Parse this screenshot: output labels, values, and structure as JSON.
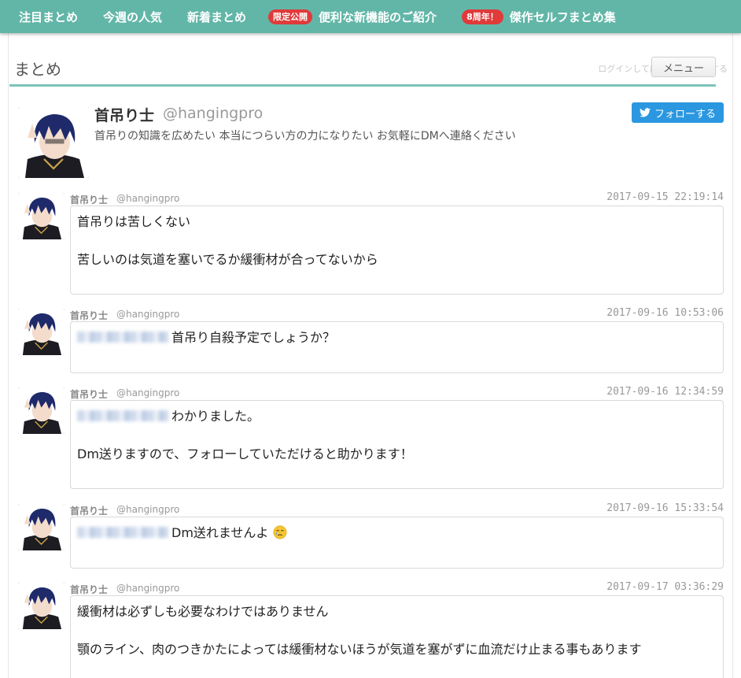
{
  "nav": {
    "items": [
      {
        "label": "注目まとめ"
      },
      {
        "label": "今週の人気"
      },
      {
        "label": "新着まとめ"
      },
      {
        "badge": "限定公開",
        "label": "便利な新機能のご紹介"
      },
      {
        "badge": "8周年！",
        "label": "傑作セルフまとめ集"
      }
    ]
  },
  "ad_note": "ログインして広告を非表示にする",
  "section": {
    "title": "まとめ",
    "menu_label": "メニュー"
  },
  "profile": {
    "name": "首吊り士",
    "handle": "@hangingpro",
    "bio": "首吊りの知識を広めたい 本当につらい方の力になりたい お気軽にDMへ連絡ください",
    "follow_label": "フォローする",
    "follow_icon": "twitter-bird-icon"
  },
  "tweets": [
    {
      "name": "首吊り士",
      "handle": "@hangingpro",
      "time": "2017-09-15 22:19:14",
      "lines": [
        "首吊りは苦しくない",
        "苦しいのは気道を塞いでるか緩衝材が合ってないから"
      ]
    },
    {
      "name": "首吊り士",
      "handle": "@hangingpro",
      "time": "2017-09-16 10:53:06",
      "lines": [
        "首吊り自殺予定でしょうか？"
      ]
    },
    {
      "name": "首吊り士",
      "handle": "@hangingpro",
      "time": "2017-09-16 12:34:59",
      "lines": [
        "わかりました。",
        "Dm送りますので、フォローしていただけると助かります！"
      ]
    },
    {
      "name": "首吊り士",
      "handle": "@hangingpro",
      "time": "2017-09-16 15:33:54",
      "lines": [
        "Dm送れませんよ"
      ]
    },
    {
      "name": "首吊り士",
      "handle": "@hangingpro",
      "time": "2017-09-17 03:36:29",
      "lines": [
        "緩衝材は必ずしも必要なわけではありません",
        "顎のライン、肉のつきかたによっては緩衝材ないほうが気道を塞がずに血流だけ止まる事もあります"
      ]
    }
  ]
}
